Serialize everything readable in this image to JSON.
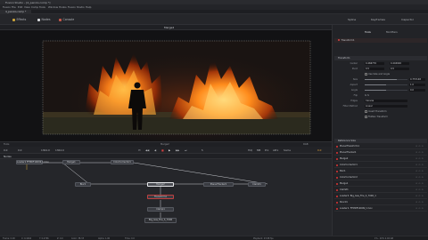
{
  "app": {
    "title": "Fusion Studio - [4_penzio.comp *]",
    "menu": [
      "Fusion",
      "File",
      "Edit",
      "View",
      "Comp",
      "Tools",
      "Window",
      "Hooks",
      "Fusion Studio",
      "Help"
    ],
    "tab": "4_penzio.comp *"
  },
  "toolbar": {
    "effects_label": "Effects",
    "nodes_label": "Nodes",
    "console_label": "Console",
    "spline_label": "Spline",
    "keyframes_label": "Keyframes",
    "inspector_label": "Inspector"
  },
  "viewer": {
    "title": "Merge2",
    "footer": [
      "Tools",
      "Merge2",
      "RGB"
    ]
  },
  "transport": {
    "start": "0.0",
    "cur": "0.0",
    "end": "1364.0",
    "end2": "1364.0",
    "frame": "0.0",
    "hiq": "HiQ",
    "mb": "MB",
    "prx": "Prx",
    "aprx": "APrx",
    "some": "Some"
  },
  "node_editor": {
    "title": "Nodes",
    "nodes": [
      "Loader1 FFMDF19099_t.mov",
      "Merge1",
      "ColorCorrector1",
      "Merge2",
      "PlanarTracker1",
      "Blur1",
      "Clamit1",
      "Transform1",
      "Clamp1",
      "Big_Gas_Fire_S_7006"
    ]
  },
  "statusbar": {
    "items": [
      "Frame: 0.00",
      "X: 0.4264",
      "Y: 0.4706",
      "Z: 0.0",
      "Color: 38.33",
      "Alpha: 1.00",
      "Time: 0.0",
      "Playback: 23.98 fps",
      "1% - 20% 2.04 GB"
    ]
  },
  "inspector": {
    "title": "Inspector",
    "tabs": [
      "Tools",
      "Modifiers"
    ],
    "tool_name": "Transform1",
    "section": "Transform",
    "props": {
      "center": {
        "label": "Center",
        "x": "0.466776",
        "y": "0.404926"
      },
      "pivot": {
        "label": "Pivot",
        "x": "0.5",
        "y": "0.5"
      },
      "use_size_angle": "Use Size and Angle",
      "size": {
        "label": "Size",
        "x": "0.757148"
      },
      "aspect": {
        "label": "Aspect",
        "x": "1.0"
      },
      "angle": {
        "label": "Angle",
        "x": "0.0"
      },
      "edges": {
        "label": "Edges",
        "value": "Canvas"
      },
      "flip": {
        "label": "Flip"
      },
      "filter_method": {
        "label": "Filter Method",
        "value": "Linear"
      },
      "invert_transform": "Invert Transform",
      "flatten_transform": "Flatten Transform"
    },
    "ref_title": "Reference Size",
    "list": [
      "PlanarTransform1",
      "PlanarTracker1",
      "Merge2",
      "ColorCorrector1",
      "Blur1",
      "ColorCorrector2",
      "Merge1",
      "Clamit1",
      "Loader2: Big_Gas_Fire_S_7006_1",
      "Pencil1",
      "Loader1: FFMDF19099_t.mov"
    ]
  },
  "colors": {
    "accent": "#e2a23a",
    "node_selected": "#e6e7ea",
    "status_red": "#d44040"
  }
}
